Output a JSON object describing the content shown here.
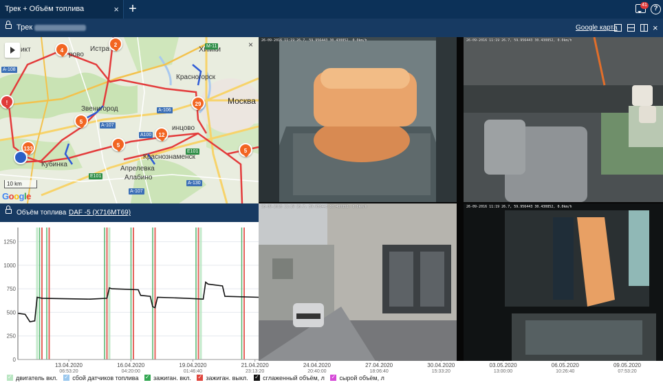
{
  "tab": {
    "title": "Трек + Объём топлива",
    "close": "×",
    "add": "+"
  },
  "topbar": {
    "notification_count": "41",
    "help": "?"
  },
  "track": {
    "label": "Трек",
    "google_map_link": "Google карта",
    "close": "×"
  },
  "map": {
    "scale": "10 km",
    "google": "Google",
    "close": "×",
    "labels": {
      "khimki": "Химки",
      "moskva": "Москва",
      "krasnogorsk": "Красногорск",
      "zvenigorod": "Звенигород",
      "istra": "Истра",
      "pavlovo": "рово",
      "ikt": "икт",
      "kubinka": "Кубинка",
      "odintsovo": "инцово",
      "krasnoznamensk": "Краснознаменск",
      "aprelevka": "Апрелевка",
      "alabino": "Алабино"
    },
    "roads": [
      "M-11",
      "A-108",
      "A-106",
      "A-107",
      "A100",
      "E101",
      "A-107",
      "A-130",
      "E101"
    ],
    "markers": [
      "4",
      "2",
      "29",
      "5",
      "12",
      "5",
      "5",
      "133",
      "!"
    ]
  },
  "fuel": {
    "title": "Объём топлива",
    "vehicle": "DAF -5 (Х716МТ69)"
  },
  "cameras": [
    {
      "osd": "26-09-2016 11:19 26.7, 59.956443 30.430852, 0.0km/h"
    },
    {
      "osd": "26-09-2016 11:19 26.7, 59.956443 30.430852, 0.0km/h"
    },
    {
      "osd": "26-09-2016 11:19 26.7, 59.956443 30.430852, 0.0km/h"
    },
    {
      "osd": "26-09-2016 11:19 26.7, 59.956443 30.430852, 0.0km/h"
    }
  ],
  "chart_data": {
    "type": "line",
    "ylim": [
      0,
      1400
    ],
    "y_ticks": [
      0,
      250,
      500,
      750,
      1000,
      1250
    ],
    "x_ticks": [
      {
        "date": "13.04.2020",
        "time": "06:53:20"
      },
      {
        "date": "16.04.2020",
        "time": "04:20:00"
      },
      {
        "date": "19.04.2020",
        "time": "01:46:40"
      },
      {
        "date": "21.04.2020",
        "time": "23:13:20"
      },
      {
        "date": "24.04.2020",
        "time": "20:40:00"
      },
      {
        "date": "27.04.2020",
        "time": "18:06:40"
      },
      {
        "date": "30.04.2020",
        "time": "15:33:20"
      },
      {
        "date": "03.05.2020",
        "time": "13:00:00"
      },
      {
        "date": "06.05.2020",
        "time": "10:26:40"
      },
      {
        "date": "09.05.2020",
        "time": "07:53:20"
      }
    ],
    "smoothed_volume": [
      [
        0.0,
        490
      ],
      [
        0.03,
        480
      ],
      [
        0.05,
        400
      ],
      [
        0.07,
        410
      ],
      [
        0.08,
        660
      ],
      [
        0.1,
        650
      ],
      [
        0.3,
        640
      ],
      [
        0.37,
        650
      ],
      [
        0.38,
        760
      ],
      [
        0.39,
        750
      ],
      [
        0.5,
        740
      ],
      [
        0.51,
        680
      ],
      [
        0.55,
        670
      ],
      [
        0.56,
        560
      ],
      [
        0.57,
        550
      ],
      [
        0.58,
        660
      ],
      [
        0.7,
        650
      ],
      [
        0.77,
        640
      ],
      [
        0.78,
        820
      ],
      [
        0.79,
        800
      ],
      [
        0.85,
        780
      ],
      [
        0.86,
        670
      ],
      [
        1.0,
        660
      ]
    ],
    "ignition_on_events": [
      0.09,
      0.12,
      0.36,
      0.47,
      0.56,
      0.74,
      0.93
    ],
    "ignition_off_events": [
      0.1,
      0.13,
      0.37,
      0.48,
      0.57,
      0.75,
      0.94
    ],
    "engine_on_events": [
      0.08,
      0.38,
      0.76
    ],
    "legend": [
      {
        "label": "двигатель вкл.",
        "color": "#b9e6c2"
      },
      {
        "label": "сбой датчиков топлива",
        "color": "#9bc8ee"
      },
      {
        "label": "зажиган. вкл.",
        "color": "#34a853"
      },
      {
        "label": "зажиган. выкл.",
        "color": "#e0463e"
      },
      {
        "label": "сглаженный объём, л",
        "color": "#111111"
      },
      {
        "label": "сырой объём, л",
        "color": "#d64ad8"
      }
    ]
  }
}
